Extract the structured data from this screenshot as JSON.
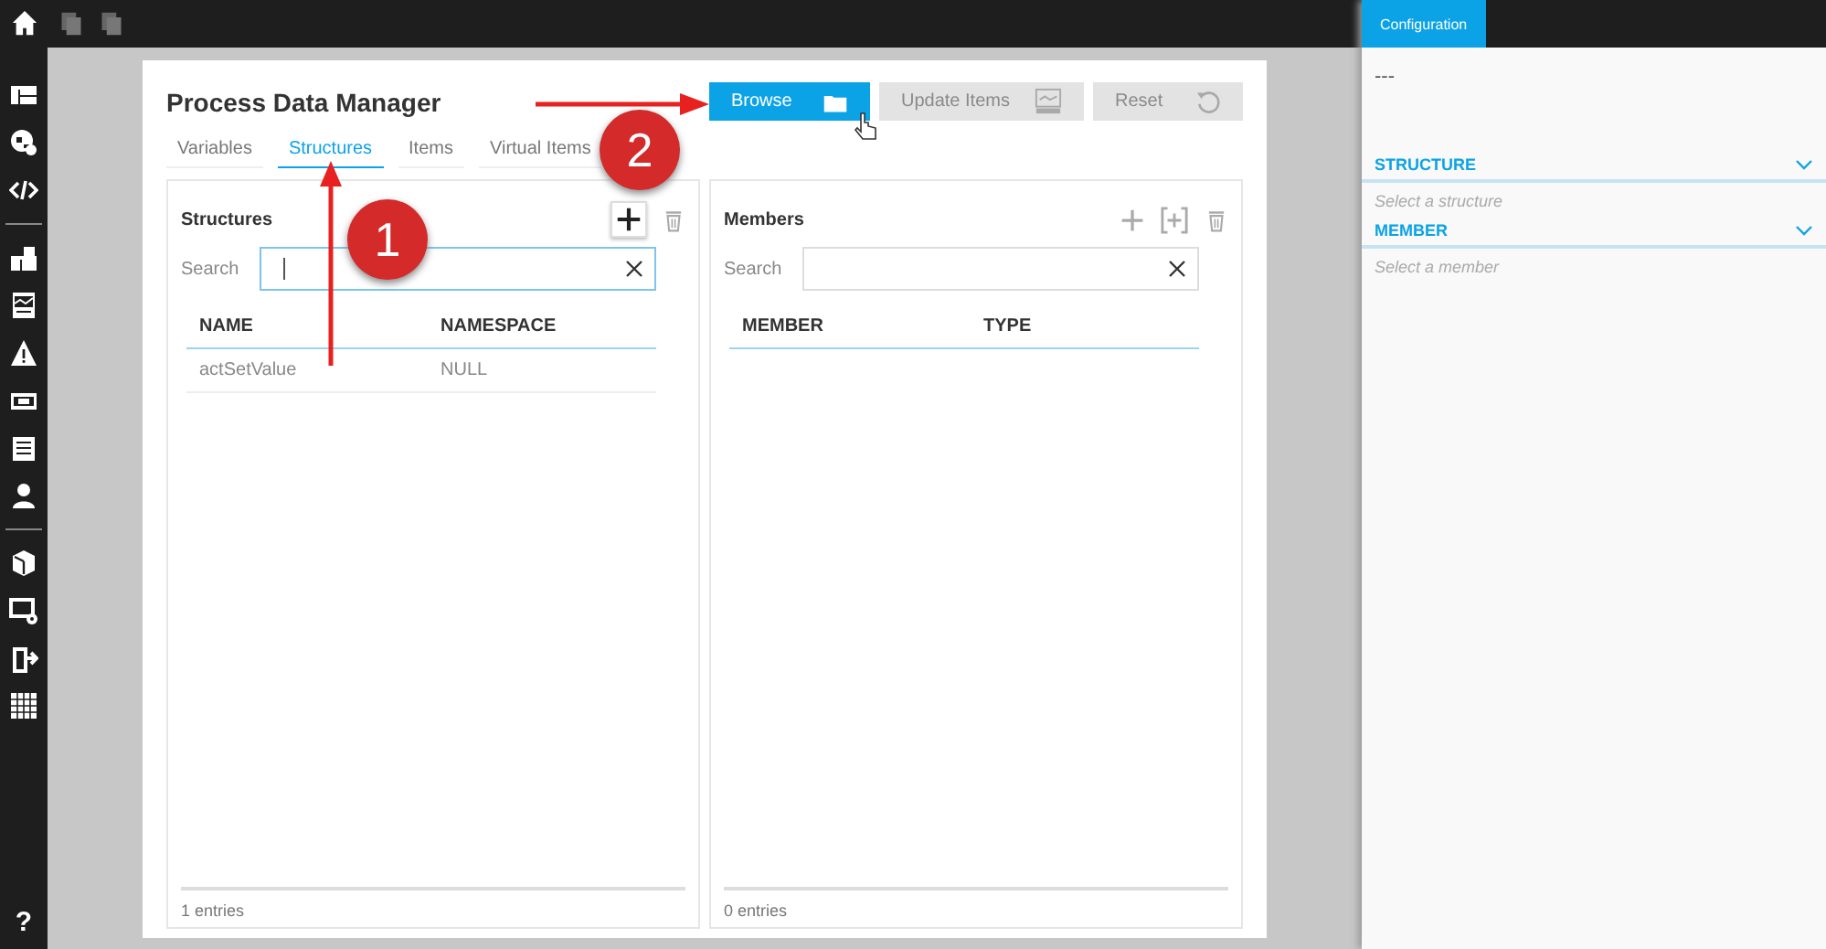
{
  "title": "Process Data Manager",
  "toolbar_buttons": [
    {
      "label": "Browse",
      "kind": "browse",
      "disabled": false
    },
    {
      "label": "Update Items",
      "kind": "update",
      "disabled": true
    },
    {
      "label": "Reset",
      "kind": "reset",
      "disabled": true
    }
  ],
  "tabs": [
    {
      "label": "Variables",
      "selected": false
    },
    {
      "label": "Structures",
      "selected": true
    },
    {
      "label": "Items",
      "selected": false
    },
    {
      "label": "Virtual Items",
      "selected": false
    }
  ],
  "structures_panel": {
    "title": "Structures",
    "search_label": "Search",
    "search_focused": true,
    "columns": [
      "NAME",
      "NAMESPACE"
    ],
    "rows": [
      [
        "actSetValue",
        "NULL"
      ]
    ],
    "footer": "1 entries"
  },
  "members_panel": {
    "title": "Members",
    "search_label": "Search",
    "search_focused": false,
    "columns": [
      "MEMBER",
      "TYPE"
    ],
    "footer": "0 entries"
  },
  "configuration": {
    "tab": "Configuration",
    "value": "---",
    "sections": [
      {
        "label": "STRUCTURE",
        "placeholder": "Select a structure"
      },
      {
        "label": "MEMBER",
        "placeholder": "Select a member"
      }
    ]
  },
  "annotations": [
    {
      "label": "1"
    },
    {
      "label": "2"
    }
  ],
  "sidebar_help": "?"
}
